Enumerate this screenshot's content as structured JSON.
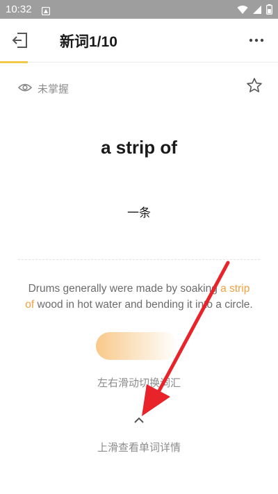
{
  "status_bar": {
    "time": "10:32",
    "icons": [
      "notification-icon",
      "wifi-icon",
      "signal-icon",
      "battery-icon"
    ]
  },
  "header": {
    "title": "新词1/10",
    "back_icon": "exit-icon",
    "more_icon": "more-icon",
    "progress": 0.1,
    "accent_color": "#f2c94c"
  },
  "card": {
    "mastery_label": "未掌握",
    "mastery_icon": "eye-icon",
    "star_icon": "star-icon",
    "word": "a strip of",
    "meaning": "一条",
    "example": {
      "before": "Drums generally were made by soaking ",
      "highlight": "a strip of",
      "after": " wood in hot water and bending it into a circle.",
      "highlight_color": "#f0a040"
    },
    "swipe_hint": "左右滑动切换词汇",
    "detail_hint": "上滑查看单词详情"
  },
  "annotation": {
    "arrow_color": "#e8232a"
  }
}
